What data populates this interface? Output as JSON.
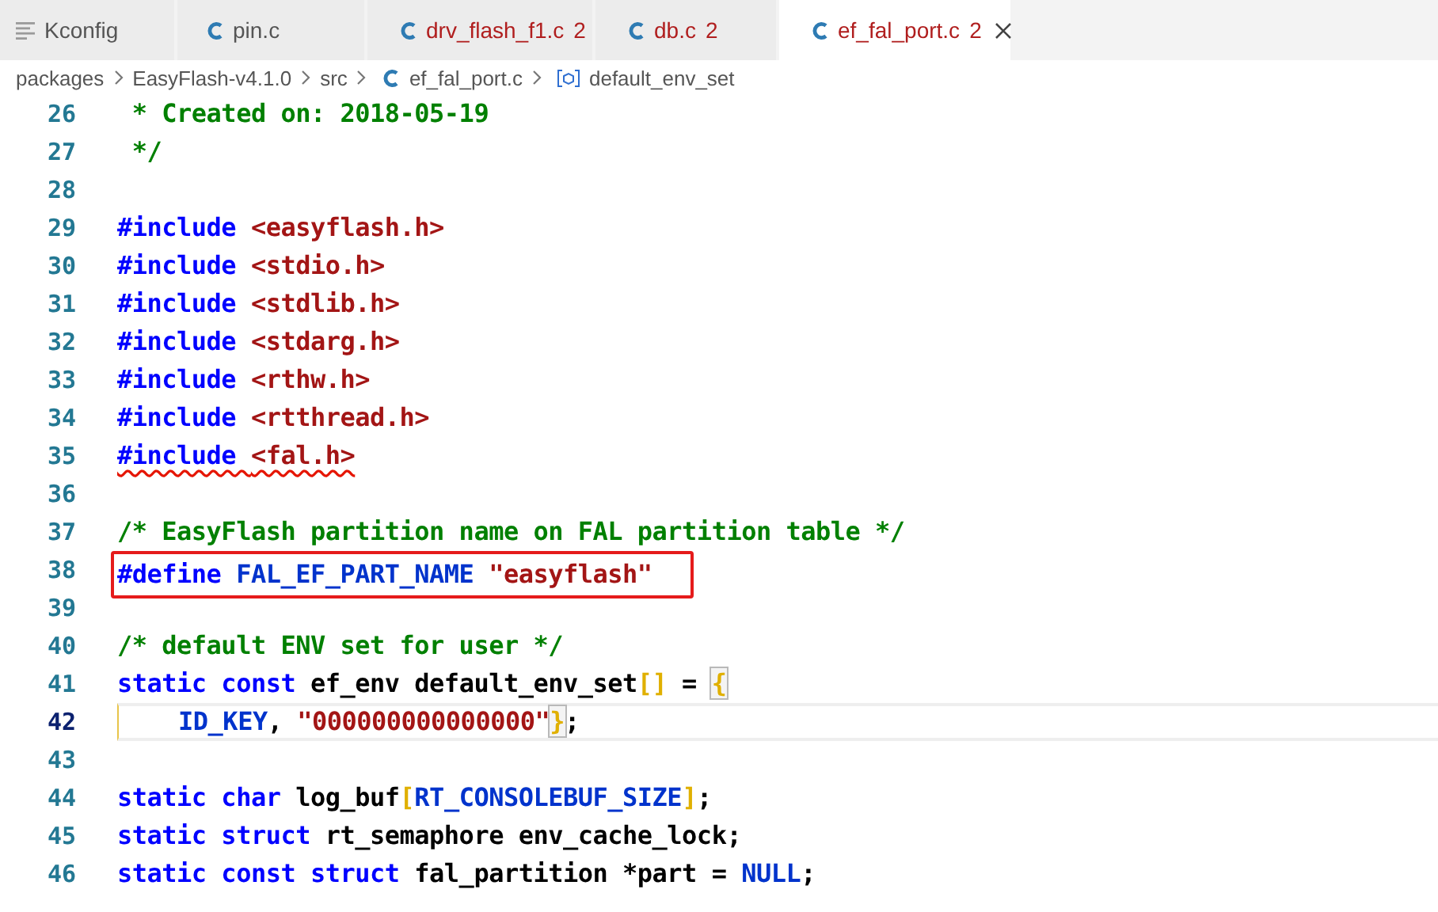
{
  "tabs": [
    {
      "label": "Kconfig",
      "kind": "config",
      "selected": false
    },
    {
      "label": "pin.c",
      "kind": "c",
      "selected": false
    },
    {
      "label": "drv_flash_f1.c",
      "kind": "c",
      "problems": "2",
      "selected": false
    },
    {
      "label": "db.c",
      "kind": "c",
      "problems": "2",
      "selected": false
    },
    {
      "label": "ef_fal_port.c",
      "kind": "c",
      "problems": "2",
      "selected": true
    }
  ],
  "breadcrumb": [
    {
      "label": "packages",
      "kind": "folder"
    },
    {
      "label": "EasyFlash-v4.1.0",
      "kind": "folder"
    },
    {
      "label": "src",
      "kind": "folder"
    },
    {
      "label": "ef_fal_port.c",
      "kind": "c"
    },
    {
      "label": "default_env_set",
      "kind": "symbol"
    }
  ],
  "code": [
    {
      "number": "26",
      "current": false,
      "annotated": false,
      "tokens": [
        {
          "t": " * Created on: 2018-05-19",
          "kind": "comment"
        }
      ]
    },
    {
      "number": "27",
      "current": false,
      "annotated": false,
      "tokens": [
        {
          "t": " */",
          "kind": "comment"
        }
      ]
    },
    {
      "number": "28",
      "current": false
    },
    {
      "number": "29",
      "current": false,
      "annotated": false,
      "tokens": [
        {
          "t": "#include ",
          "kind": "keyword"
        },
        {
          "t": "<easyflash.h>",
          "kind": "string"
        }
      ]
    },
    {
      "number": "30",
      "current": false,
      "annotated": false,
      "tokens": [
        {
          "t": "#include ",
          "kind": "keyword"
        },
        {
          "t": "<stdio.h>",
          "kind": "string"
        }
      ]
    },
    {
      "number": "31",
      "current": false,
      "annotated": false,
      "tokens": [
        {
          "t": "#include ",
          "kind": "keyword"
        },
        {
          "t": "<stdlib.h>",
          "kind": "string"
        }
      ]
    },
    {
      "number": "32",
      "current": false,
      "annotated": false,
      "tokens": [
        {
          "t": "#include ",
          "kind": "keyword"
        },
        {
          "t": "<stdarg.h>",
          "kind": "string"
        }
      ]
    },
    {
      "number": "33",
      "current": false,
      "annotated": false,
      "tokens": [
        {
          "t": "#include ",
          "kind": "keyword"
        },
        {
          "t": "<rthw.h>",
          "kind": "string"
        }
      ]
    },
    {
      "number": "34",
      "current": false,
      "annotated": false,
      "tokens": [
        {
          "t": "#include ",
          "kind": "keyword"
        },
        {
          "t": "<rtthread.h>",
          "kind": "string"
        }
      ]
    },
    {
      "number": "35",
      "current": false,
      "annotated": false,
      "tokens": [
        {
          "t": "#include ",
          "kind": "keyword",
          "error": true
        },
        {
          "t": "<fal.h>",
          "kind": "string",
          "error": true
        }
      ]
    },
    {
      "number": "36",
      "current": false
    },
    {
      "number": "37",
      "current": false,
      "annotated": false,
      "tokens": [
        {
          "t": "/* EasyFlash partition name on FAL partition table */",
          "kind": "comment"
        }
      ]
    },
    {
      "number": "38",
      "current": false,
      "annotated": true,
      "tokens": [
        {
          "t": "#define ",
          "kind": "keyword"
        },
        {
          "t": "FAL_EF_PART_NAME ",
          "kind": "macro"
        },
        {
          "t": "\"easyflash\"",
          "kind": "string"
        }
      ]
    },
    {
      "number": "39",
      "current": false
    },
    {
      "number": "40",
      "current": false,
      "annotated": false,
      "tokens": [
        {
          "t": "/* default ENV set for user */",
          "kind": "comment"
        }
      ]
    },
    {
      "number": "41",
      "current": false,
      "annotated": false,
      "tokens": [
        {
          "t": "static const ",
          "kind": "keyword"
        },
        {
          "t": "ef_env default_env_set",
          "kind": "text"
        },
        {
          "t": "[]",
          "kind": "bracket"
        },
        {
          "t": " = ",
          "kind": "text"
        },
        {
          "t": "{",
          "kind": "bracket",
          "matched": true
        }
      ]
    },
    {
      "number": "42",
      "current": true,
      "annotated": false,
      "tokens": [
        {
          "t": "    ID_KEY",
          "kind": "macro"
        },
        {
          "t": ", ",
          "kind": "text"
        },
        {
          "t": "\"000000000000000\"",
          "kind": "string"
        },
        {
          "t": "}",
          "kind": "bracket",
          "matched": true
        },
        {
          "t": ";",
          "kind": "text"
        }
      ]
    },
    {
      "number": "43",
      "current": false
    },
    {
      "number": "44",
      "current": false,
      "annotated": false,
      "tokens": [
        {
          "t": "static char ",
          "kind": "keyword"
        },
        {
          "t": "log_buf",
          "kind": "text"
        },
        {
          "t": "[",
          "kind": "bracket"
        },
        {
          "t": "RT_CONSOLEBUF_SIZE",
          "kind": "macro"
        },
        {
          "t": "]",
          "kind": "bracket"
        },
        {
          "t": ";",
          "kind": "text"
        }
      ]
    },
    {
      "number": "45",
      "current": false,
      "annotated": false,
      "tokens": [
        {
          "t": "static struct ",
          "kind": "keyword"
        },
        {
          "t": "rt_semaphore env_cache_lock;",
          "kind": "text"
        }
      ]
    },
    {
      "number": "46",
      "current": false,
      "annotated": false,
      "tokens": [
        {
          "t": "static const struct ",
          "kind": "keyword"
        },
        {
          "t": "fal_partition *part = ",
          "kind": "text"
        },
        {
          "t": "NULL",
          "kind": "macro"
        },
        {
          "t": ";",
          "kind": "text"
        }
      ]
    }
  ]
}
